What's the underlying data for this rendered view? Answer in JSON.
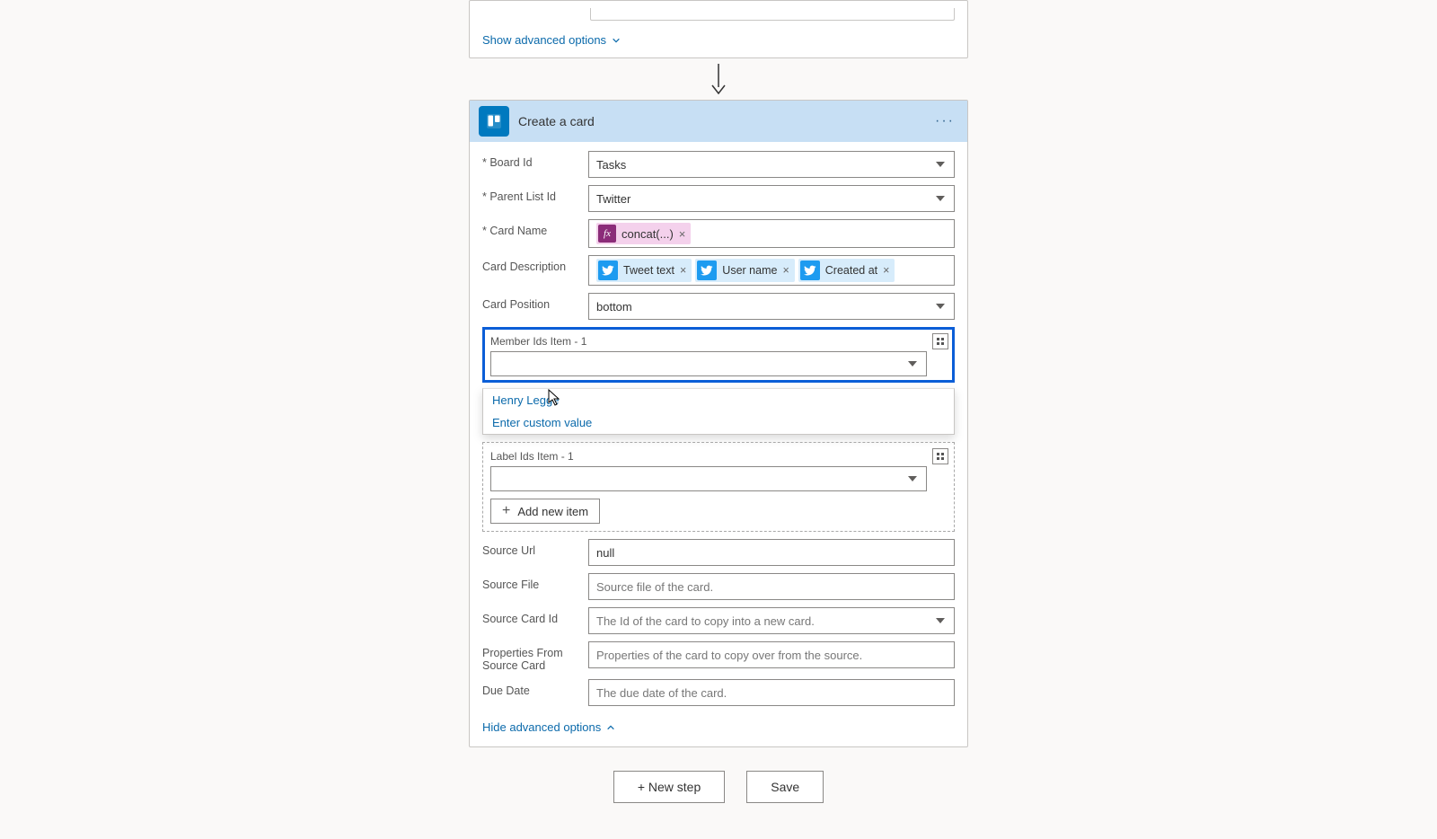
{
  "top": {
    "show_advanced": "Show advanced options"
  },
  "action": {
    "title": "Create a card",
    "labels": {
      "board_id": "Board Id",
      "parent_list_id": "Parent List Id",
      "card_name": "Card Name",
      "card_description": "Card Description",
      "card_position": "Card Position",
      "member_ids": "Member Ids Item - 1",
      "label_ids": "Label Ids Item - 1",
      "add_new_item": "Add new item",
      "source_url": "Source Url",
      "source_file": "Source File",
      "source_card_id": "Source Card Id",
      "props_from_source": "Properties From Source Card",
      "due_date": "Due Date",
      "hide_advanced": "Hide advanced options"
    },
    "values": {
      "board_id": "Tasks",
      "parent_list_id": "Twitter",
      "card_name_token": "concat(...)",
      "desc_tokens": {
        "t1": "Tweet text",
        "t2": "User name",
        "t3": "Created at"
      },
      "card_position": "bottom",
      "member_option": "Henry Legge",
      "custom_value": "Enter custom value",
      "source_url": "null",
      "source_file_ph": "Source file of the card.",
      "source_card_id_ph": "The Id of the card to copy into a new card.",
      "props_ph": "Properties of the card to copy over from the source.",
      "due_date_ph": "The due date of the card."
    }
  },
  "footer": {
    "new_step": "+ New step",
    "save": "Save"
  }
}
